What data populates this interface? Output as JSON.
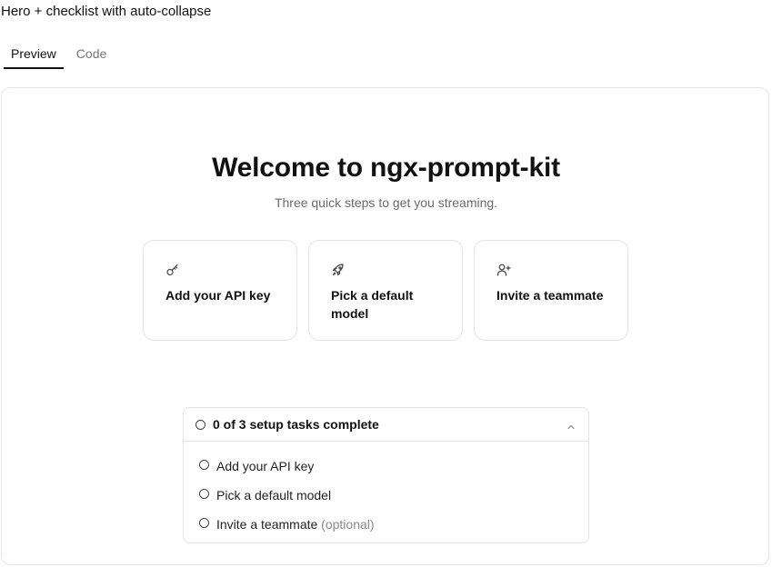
{
  "page": {
    "title": "Hero + checklist with auto-collapse"
  },
  "tabs": [
    {
      "label": "Preview",
      "active": true
    },
    {
      "label": "Code",
      "active": false
    }
  ],
  "hero": {
    "title": "Welcome to ngx-prompt-kit",
    "subtitle": "Three quick steps to get you streaming."
  },
  "steps": [
    {
      "icon": "key-icon",
      "label": "Add your API key"
    },
    {
      "icon": "rocket-icon",
      "label": "Pick a default model"
    },
    {
      "icon": "user-plus-icon",
      "label": "Invite a teammate"
    }
  ],
  "checklist": {
    "summary": "0 of 3 setup tasks complete",
    "expanded": true,
    "tasks": [
      {
        "label": "Add your API key",
        "suffix": "",
        "done": false
      },
      {
        "label": "Pick a default model",
        "suffix": "",
        "done": false
      },
      {
        "label": "Invite a teammate",
        "suffix": "(optional)",
        "done": false
      }
    ]
  },
  "colors": {
    "text": "#111111",
    "muted": "#6b6b6b",
    "border": "#e3e3e3"
  }
}
